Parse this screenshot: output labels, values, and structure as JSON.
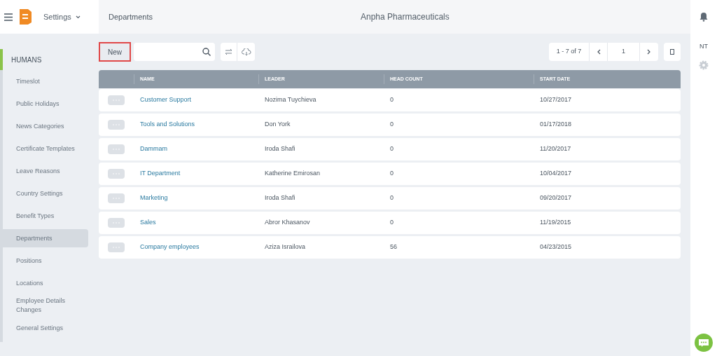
{
  "header": {
    "app_menu": "Settings",
    "breadcrumb": "Departments",
    "company": "Anpha Pharmaceuticals"
  },
  "sidebar": {
    "section": "HUMANS",
    "items": [
      {
        "label": "Timeslot",
        "selected": false
      },
      {
        "label": "Public Holidays",
        "selected": false
      },
      {
        "label": "News Categories",
        "selected": false
      },
      {
        "label": "Certificate Templates",
        "selected": false
      },
      {
        "label": "Leave Reasons",
        "selected": false
      },
      {
        "label": "Country Settings",
        "selected": false
      },
      {
        "label": "Benefit Types",
        "selected": false
      },
      {
        "label": "Departments",
        "selected": true
      },
      {
        "label": "Positions",
        "selected": false
      },
      {
        "label": "Locations",
        "selected": false
      },
      {
        "label": "Employee Details Changes",
        "selected": false
      },
      {
        "label": "General Settings",
        "selected": false
      }
    ]
  },
  "toolbar": {
    "new_button": "New",
    "pagination": {
      "range": "1 - 7 of 7",
      "page": "1"
    }
  },
  "table": {
    "columns": [
      "NAME",
      "LEADER",
      "HEAD COUNT",
      "START DATE"
    ],
    "rows": [
      {
        "name": "Customer Support",
        "leader": "Nozima Tuychieva",
        "head_count": "0",
        "start_date": "10/27/2017"
      },
      {
        "name": "Tools and Solutions",
        "leader": "Don York",
        "head_count": "0",
        "start_date": "01/17/2018"
      },
      {
        "name": "Dammam",
        "leader": "Iroda Shafi",
        "head_count": "0",
        "start_date": "11/20/2017"
      },
      {
        "name": "IT Department",
        "leader": "Katherine Emirosan",
        "head_count": "0",
        "start_date": "10/04/2017"
      },
      {
        "name": "Marketing",
        "leader": "Iroda Shafi",
        "head_count": "0",
        "start_date": "09/20/2017"
      },
      {
        "name": "Sales",
        "leader": "Abror Khasanov",
        "head_count": "0",
        "start_date": "11/19/2015"
      },
      {
        "name": "Company employees",
        "leader": "Aziza Israilova",
        "head_count": "56",
        "start_date": "04/23/2015"
      }
    ]
  },
  "right_rail": {
    "user_initials": "NT"
  }
}
